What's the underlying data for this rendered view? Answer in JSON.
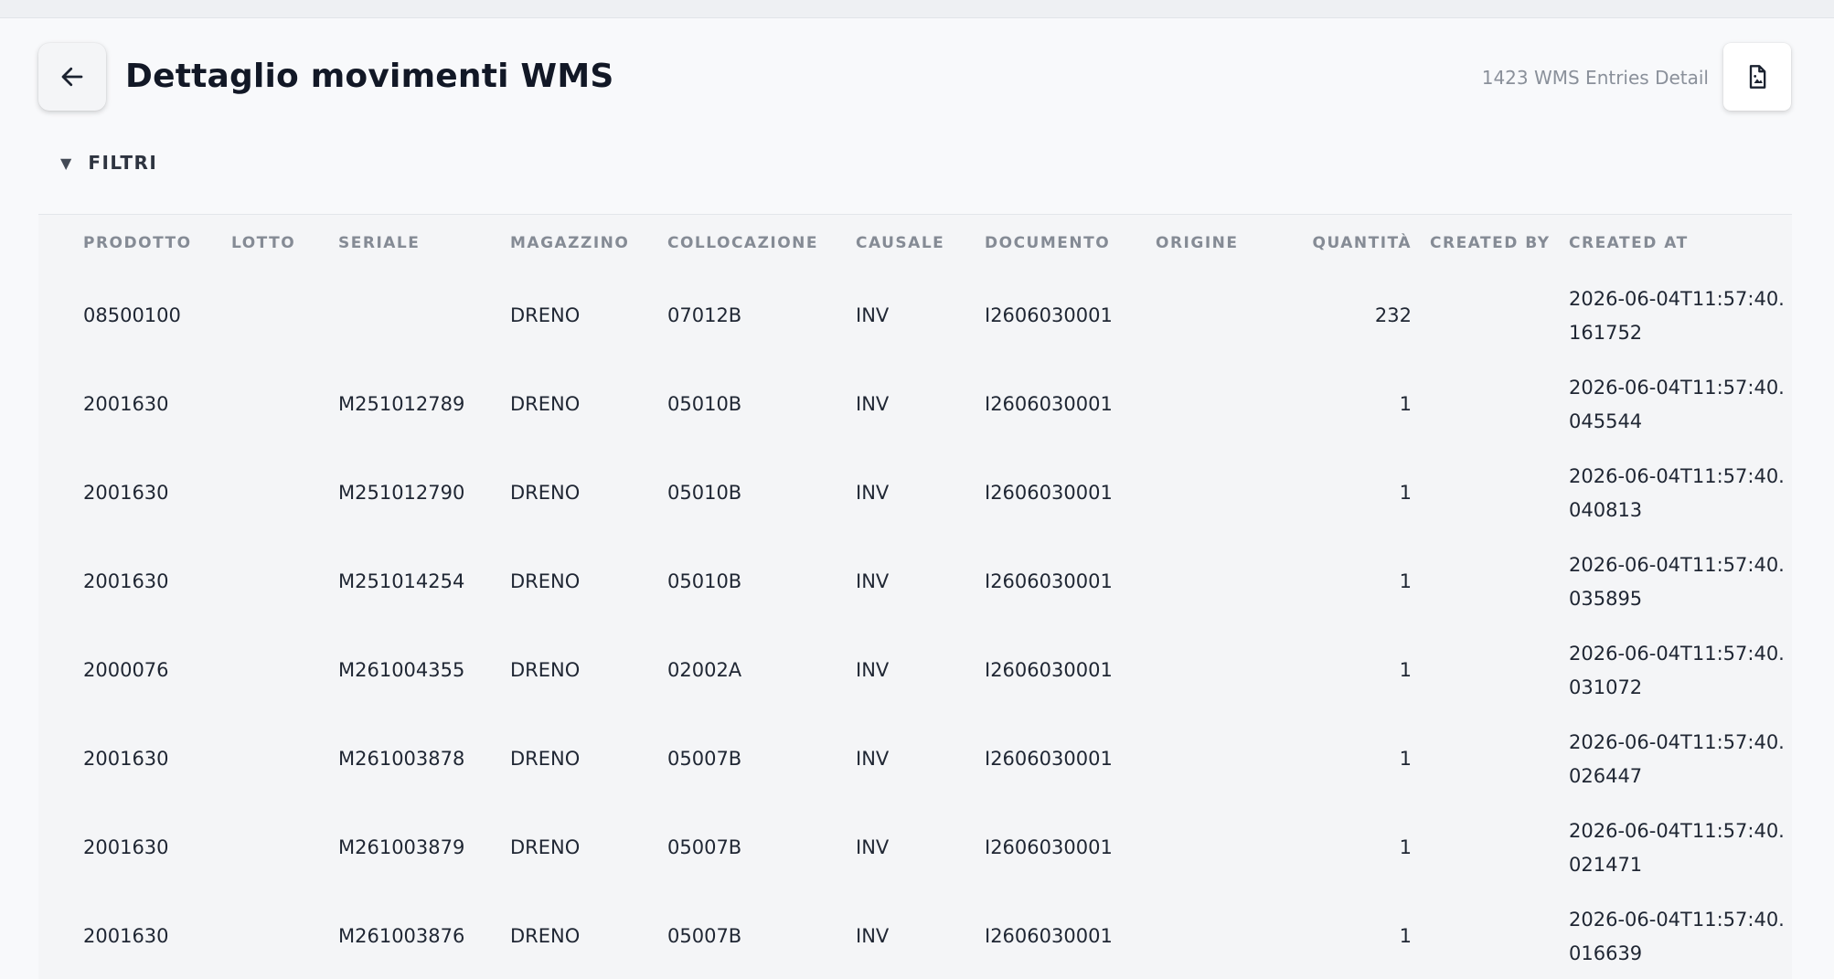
{
  "header": {
    "title": "Dettaglio movimenti WMS",
    "entries_detail": "1423 WMS Entries Detail"
  },
  "icons": {
    "back": "arrow-left-icon",
    "document": "document-image-icon",
    "filters": "caret-down-icon"
  },
  "filters": {
    "caret": "▼",
    "label": "FILTRI"
  },
  "table": {
    "columns": [
      "PRODOTTO",
      "LOTTO",
      "SERIALE",
      "MAGAZZINO",
      "COLLOCAZIONE",
      "CAUSALE",
      "DOCUMENTO",
      "ORIGINE",
      "QUANTITÀ",
      "CREATED BY",
      "CREATED AT"
    ],
    "rows": [
      {
        "prodotto": "08500100",
        "lotto": "",
        "seriale": "",
        "magazzino": "DRENO",
        "collocazione": "07012B",
        "causale": "INV",
        "documento": "I2606030001",
        "origine": "",
        "quantita": "232",
        "created_by": "",
        "created_at": "2026-06-04T11:57:40.161752"
      },
      {
        "prodotto": "2001630",
        "lotto": "",
        "seriale": "M251012789",
        "magazzino": "DRENO",
        "collocazione": "05010B",
        "causale": "INV",
        "documento": "I2606030001",
        "origine": "",
        "quantita": "1",
        "created_by": "",
        "created_at": "2026-06-04T11:57:40.045544"
      },
      {
        "prodotto": "2001630",
        "lotto": "",
        "seriale": "M251012790",
        "magazzino": "DRENO",
        "collocazione": "05010B",
        "causale": "INV",
        "documento": "I2606030001",
        "origine": "",
        "quantita": "1",
        "created_by": "",
        "created_at": "2026-06-04T11:57:40.040813"
      },
      {
        "prodotto": "2001630",
        "lotto": "",
        "seriale": "M251014254",
        "magazzino": "DRENO",
        "collocazione": "05010B",
        "causale": "INV",
        "documento": "I2606030001",
        "origine": "",
        "quantita": "1",
        "created_by": "",
        "created_at": "2026-06-04T11:57:40.035895"
      },
      {
        "prodotto": "2000076",
        "lotto": "",
        "seriale": "M261004355",
        "magazzino": "DRENO",
        "collocazione": "02002A",
        "causale": "INV",
        "documento": "I2606030001",
        "origine": "",
        "quantita": "1",
        "created_by": "",
        "created_at": "2026-06-04T11:57:40.031072"
      },
      {
        "prodotto": "2001630",
        "lotto": "",
        "seriale": "M261003878",
        "magazzino": "DRENO",
        "collocazione": "05007B",
        "causale": "INV",
        "documento": "I2606030001",
        "origine": "",
        "quantita": "1",
        "created_by": "",
        "created_at": "2026-06-04T11:57:40.026447"
      },
      {
        "prodotto": "2001630",
        "lotto": "",
        "seriale": "M261003879",
        "magazzino": "DRENO",
        "collocazione": "05007B",
        "causale": "INV",
        "documento": "I2606030001",
        "origine": "",
        "quantita": "1",
        "created_by": "",
        "created_at": "2026-06-04T11:57:40.021471"
      },
      {
        "prodotto": "2001630",
        "lotto": "",
        "seriale": "M261003876",
        "magazzino": "DRENO",
        "collocazione": "05007B",
        "causale": "INV",
        "documento": "I2606030001",
        "origine": "",
        "quantita": "1",
        "created_by": "",
        "created_at": "2026-06-04T11:57:40.016639"
      }
    ]
  }
}
